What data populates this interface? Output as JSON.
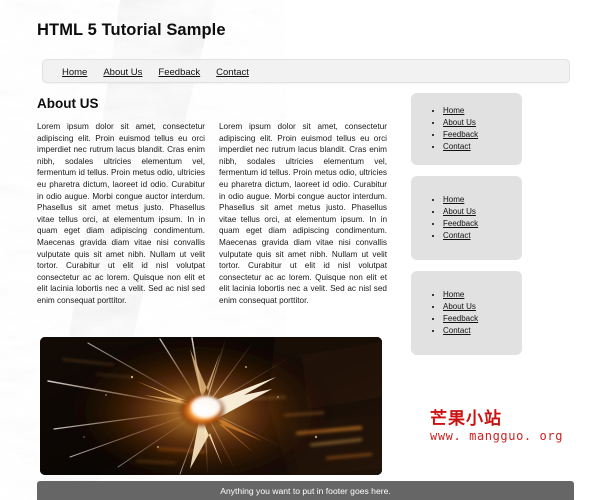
{
  "header": {
    "title": "HTML 5 Tutorial Sample"
  },
  "nav": {
    "items": [
      {
        "label": "Home"
      },
      {
        "label": "About Us"
      },
      {
        "label": "Feedback"
      },
      {
        "label": "Contact"
      }
    ]
  },
  "main": {
    "heading": "About US",
    "columns": [
      {
        "text": "Lorem ipsum dolor sit amet, consectetur adipiscing elit. Proin euismod tellus eu orci imperdiet nec rutrum lacus blandit. Cras enim nibh, sodales ultricies elementum vel, fermentum id tellus. Proin metus odio, ultricies eu pharetra dictum, laoreet id odio. Curabitur in odio augue. Morbi congue auctor interdum. Phasellus sit amet metus justo. Phasellus vitae tellus orci, at elementum ipsum. In in quam eget diam adipiscing condimentum. Maecenas gravida diam vitae nisi convallis vulputate quis sit amet nibh. Nullam ut velit tortor. Curabitur ut elit id nisl volutpat consectetur ac ac lorem. Quisque non elit et elit lacinia lobortis nec a velit. Sed ac nisl sed enim consequat porttitor."
      },
      {
        "text": "Lorem ipsum dolor sit amet, consectetur adipiscing elit. Proin euismod tellus eu orci imperdiet nec rutrum lacus blandit. Cras enim nibh, sodales ultricies elementum vel, fermentum id tellus. Proin metus odio, ultricies eu pharetra dictum, laoreet id odio. Curabitur in odio augue. Morbi congue auctor interdum. Phasellus sit amet metus justo. Phasellus vitae tellus orci, at elementum ipsum. In in quam eget diam adipiscing condimentum. Maecenas gravida diam vitae nisi convallis vulputate quis sit amet nibh. Nullam ut velit tortor. Curabitur ut elit id nisl volutpat consectetur ac ac lorem. Quisque non elit et elit lacinia lobortis nec a velit. Sed ac nisl sed enim consequat porttitor."
      }
    ],
    "hero_image_alt": "abstract-explosion-light-burst"
  },
  "sidebar": {
    "boxes": [
      {
        "links": [
          {
            "label": "Home"
          },
          {
            "label": "About Us"
          },
          {
            "label": "Feedback"
          },
          {
            "label": "Contact"
          }
        ]
      },
      {
        "links": [
          {
            "label": "Home"
          },
          {
            "label": "About Us"
          },
          {
            "label": "Feedback"
          },
          {
            "label": "Contact"
          }
        ]
      },
      {
        "links": [
          {
            "label": "Home"
          },
          {
            "label": "About Us"
          },
          {
            "label": "Feedback"
          },
          {
            "label": "Contact"
          }
        ]
      }
    ]
  },
  "watermark": {
    "title": "芒果小站",
    "url": "www. mangguo. org",
    "color": "#cc1111"
  },
  "footer": {
    "text": "Anything you want to put in footer goes here."
  },
  "colors": {
    "page_background": "#ffffff",
    "navbar_background": "#f2f2f2",
    "sidebar_box_background": "#e1e1e1",
    "footer_background": "#666666",
    "footer_text": "#ffffff",
    "link_text": "#111111",
    "body_text": "#1a1a1a"
  }
}
